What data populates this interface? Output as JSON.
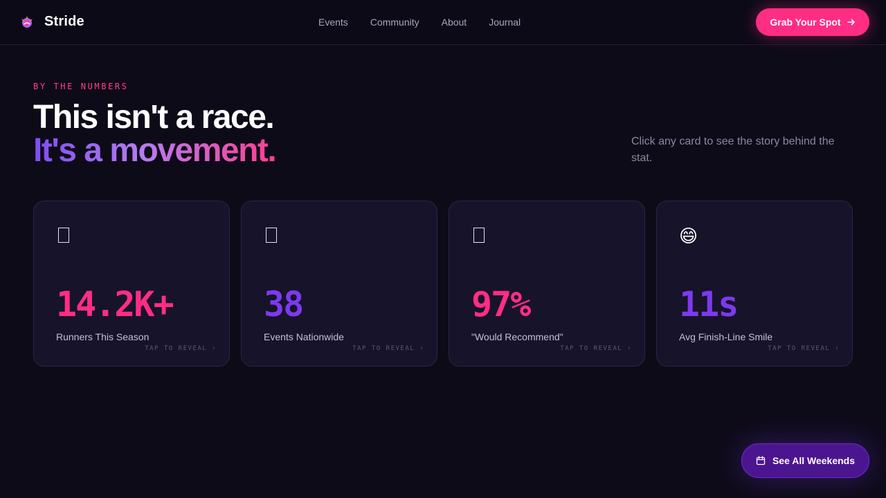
{
  "brand": {
    "name": "Stride",
    "logo_icon": "running-shoe-sparkle-icon"
  },
  "nav": {
    "items": [
      "Events",
      "Community",
      "About",
      "Journal"
    ]
  },
  "cta": {
    "label": "Grab Your Spot",
    "icon": "arrow-right-icon"
  },
  "hero": {
    "eyebrow": "BY THE NUMBERS",
    "headline_line1": "This isn't a race.",
    "headline_line2": "It's a movement.",
    "hint": "Click any card to see the story behind the stat."
  },
  "cards": [
    {
      "icon": "missing-glyph-icon",
      "value": "14.2K+",
      "label": "Runners This Season",
      "reveal": "TAP TO REVEAL ›"
    },
    {
      "icon": "missing-glyph-icon",
      "value": "38",
      "label": "Events Nationwide",
      "reveal": "TAP TO REVEAL ›"
    },
    {
      "icon": "missing-glyph-icon",
      "value": "97%",
      "label": "\"Would Recommend\"",
      "reveal": "TAP TO REVEAL ›"
    },
    {
      "icon": "grinning-face-icon",
      "value": "11s",
      "label": "Avg Finish-Line Smile",
      "reveal": "TAP TO REVEAL ›",
      "glyph": "😄"
    }
  ],
  "floating_button": {
    "label": "See All Weekends",
    "icon": "calendar-icon"
  },
  "colors": {
    "background": "#0e0b19",
    "accent_pink": "#ff2d83",
    "accent_violet": "#7c3aed",
    "card": "#17132a"
  }
}
